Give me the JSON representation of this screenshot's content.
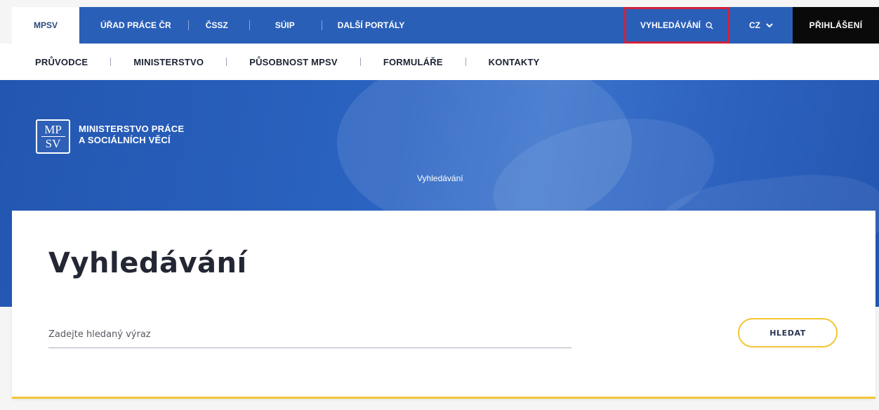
{
  "topbar": {
    "portals": [
      {
        "label": "MPSV",
        "active": true
      },
      {
        "label": "ÚŘAD PRÁCE ČR"
      },
      {
        "label": "ČSSZ"
      },
      {
        "label": "SÚIP"
      },
      {
        "label": "DALŠÍ PORTÁLY"
      }
    ],
    "search_label": "VYHLEDÁVÁNÍ",
    "language": "CZ",
    "login_label": "PŘIHLÁŠENÍ"
  },
  "main_nav": {
    "items": [
      "PRŮVODCE",
      "MINISTERSTVO",
      "PŮSOBNOST MPSV",
      "FORMULÁŘE",
      "KONTAKTY"
    ]
  },
  "hero": {
    "logo_mark_top": "MP",
    "logo_mark_bottom": "SV",
    "logo_line1": "MINISTERSTVO PRÁCE",
    "logo_line2": "A SOCIÁLNÍCH VĚCÍ",
    "breadcrumb": "Vyhledávání"
  },
  "search": {
    "title": "Vyhledávání",
    "placeholder": "Zadejte hledaný výraz",
    "value": "",
    "button_label": "HLEDAT"
  },
  "colors": {
    "brand_blue": "#2a5fb8",
    "accent_yellow": "#f2c536",
    "highlight_red": "#d0213c"
  }
}
